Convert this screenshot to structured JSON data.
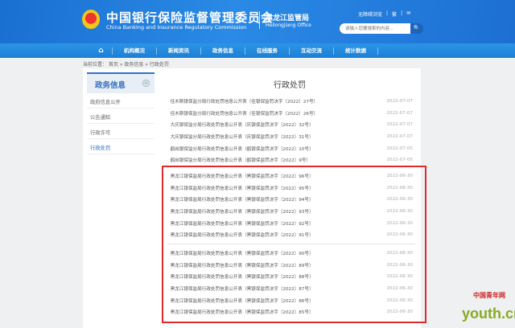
{
  "header": {
    "title_cn": "中国银行保险监督管理委员会",
    "title_en": "China Banking and Insurance Regulatory Commission",
    "office_cn": "黑龙江监管局",
    "office_en": "Heilongjiang Office",
    "links": [
      "无障碍浏览",
      "|",
      "繁",
      "|",
      "✉"
    ],
    "search_placeholder": "请输入您要搜索的内容...",
    "search_icon": "🔍"
  },
  "nav": {
    "home_icon": "⌂",
    "items": [
      "机构概况",
      "新闻资讯",
      "政务信息",
      "在线服务",
      "互动交流",
      "统计数据"
    ]
  },
  "breadcrumb": "当前位置： 首页 » 政务信息 » 行政处罚",
  "sidebar": {
    "heading": "政务信息",
    "toggle": "⊖",
    "items": [
      "政府信息公开",
      "公告通知",
      "行政许可",
      "行政处罚"
    ]
  },
  "main": {
    "title": "行政处罚",
    "rows_top": [
      {
        "t": "佳木斯银保监分局行政处罚信息公开表（佳银保监罚决字〔2022〕27号）",
        "d": "2022-07-07"
      },
      {
        "t": "佳木斯银保监分局行政处罚信息公开表（佳银保监罚决字〔2022〕26号）",
        "d": "2022-07-07"
      },
      {
        "t": "大庆银保监分局行政处罚信息公开表（庆银保监罚决字〔2022〕32号）",
        "d": "2022-07-07"
      },
      {
        "t": "大庆银保监分局行政处罚信息公开表（庆银保监罚决字〔2022〕31号）",
        "d": "2022-07-07"
      },
      {
        "t": "鹤岗银保监分局行政处罚信息公开表（鹤银保监罚决字〔2022〕10号）",
        "d": "2022-07-05"
      },
      {
        "t": "鹤岗银保监分局行政处罚信息公开表（鹤银保监罚决字〔2022〕9号）",
        "d": "2022-07-05"
      }
    ],
    "rows_a": [
      {
        "t": "黑龙江银保监局行政处罚信息公开表（黑银保监罚决字〔2022〕96号）",
        "d": "2022-06-30"
      },
      {
        "t": "黑龙江银保监局行政处罚信息公开表（黑银保监罚决字〔2022〕95号）",
        "d": "2022-06-30"
      },
      {
        "t": "黑龙江银保监局行政处罚信息公开表（黑银保监罚决字〔2022〕94号）",
        "d": "2022-06-30"
      },
      {
        "t": "黑龙江银保监局行政处罚信息公开表（黑银保监罚决字〔2022〕93号）",
        "d": "2022-06-30"
      },
      {
        "t": "黑龙江银保监局行政处罚信息公开表（黑银保监罚决字〔2022〕92号）",
        "d": "2022-06-30"
      },
      {
        "t": "黑龙江银保监局行政处罚信息公开表（黑银保监罚决字〔2022〕91号）",
        "d": "2022-06-30"
      }
    ],
    "rows_b": [
      {
        "t": "黑龙江银保监局行政处罚信息公开表（黑银保监罚决字〔2022〕90号）",
        "d": "2022-06-30"
      },
      {
        "t": "黑龙江银保监局行政处罚信息公开表（黑银保监罚决字〔2022〕89号）",
        "d": "2022-06-30"
      },
      {
        "t": "黑龙江银保监局行政处罚信息公开表（黑银保监罚决字〔2022〕88号）",
        "d": "2022-06-30"
      },
      {
        "t": "黑龙江银保监局行政处罚信息公开表（黑银保监罚决字〔2022〕87号）",
        "d": "2022-06-30"
      },
      {
        "t": "黑龙江银保监局行政处罚信息公开表（黑银保监罚决字〔2022〕86号）",
        "d": "2022-06-30"
      },
      {
        "t": "黑龙江银保监局行政处罚信息公开表（黑银保监罚决字〔2022〕85号）",
        "d": "2022-06-30"
      }
    ]
  },
  "watermark": {
    "cn": "中国青年网",
    "en": "youth.cn"
  },
  "colors": {
    "brand": "#1a6fd0",
    "highlight": "#e02a2a"
  }
}
